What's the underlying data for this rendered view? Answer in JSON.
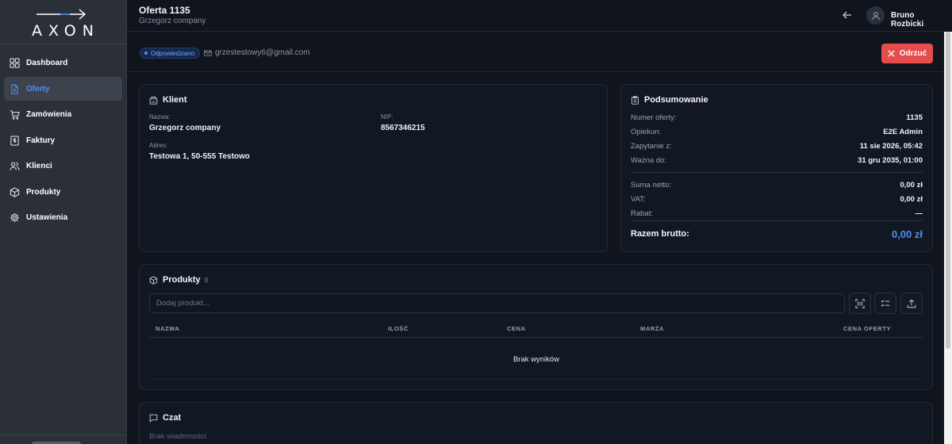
{
  "sidebar": {
    "logo_text": "AXON",
    "items": [
      {
        "label": "Dashboard",
        "icon": "grid-icon"
      },
      {
        "label": "Oferty",
        "icon": "document-icon",
        "active": true
      },
      {
        "label": "Zamówienia",
        "icon": "cart-icon"
      },
      {
        "label": "Faktury",
        "icon": "invoice-icon"
      },
      {
        "label": "Klienci",
        "icon": "users-icon"
      },
      {
        "label": "Produkty",
        "icon": "box-icon"
      },
      {
        "label": "Ustawienia",
        "icon": "gear-icon"
      }
    ]
  },
  "header": {
    "title": "Oferta 1135",
    "subtitle": "Grzegorz company",
    "user_name": "Bruno Rozbicki"
  },
  "status": {
    "badge": "Odpowiedziano",
    "email": "grzestestowy6@gmail.com",
    "reject_label": "Odrzuć"
  },
  "client": {
    "title": "Klient",
    "name_label": "Nazwa:",
    "name_value": "Grzegorz company",
    "nip_label": "NIP:",
    "nip_value": "8567346215",
    "address_label": "Adres:",
    "address_value": "Testowa 1, 50-555 Testowo"
  },
  "summary": {
    "title": "Podsumowanie",
    "rows": [
      {
        "label": "Numer oferty:",
        "value": "1135"
      },
      {
        "label": "Opiekun:",
        "value": "E2E Admin"
      },
      {
        "label": "Zapytanie z:",
        "value": "11 sie 2026, 05:42"
      },
      {
        "label": "Ważna do:",
        "value": "31 gru 2035, 01:00"
      }
    ],
    "totals": [
      {
        "label": "Suma netto:",
        "value": "0,00 zł"
      },
      {
        "label": "VAT:",
        "value": "0,00 zł"
      },
      {
        "label": "Rabat:",
        "value": "—"
      }
    ],
    "gross_label": "Razem brutto:",
    "gross_value": "0,00 zł"
  },
  "products": {
    "title": "Produkty",
    "count": "0",
    "search_placeholder": "Dodaj produkt...",
    "columns": [
      "NAZWA",
      "ILOŚĆ",
      "CENA",
      "MARŻA",
      "CENA OFERTY"
    ],
    "empty_text": "Brak wyników"
  },
  "chat": {
    "title": "Czat",
    "empty_text": "Brak wiadomości"
  },
  "colors": {
    "accent": "#4d8ef7",
    "danger": "#e64c4c",
    "sidebar_bg": "#2a2f38",
    "main_bg": "#0f141d"
  }
}
